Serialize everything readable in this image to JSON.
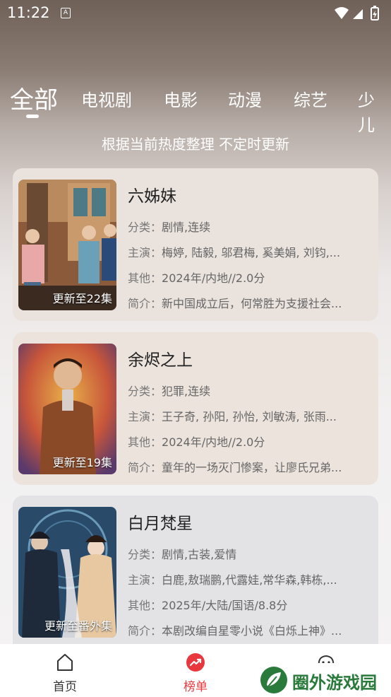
{
  "status_bar": {
    "time": "11:22",
    "notification_badge": "A"
  },
  "tabs": [
    {
      "label": "全部",
      "active": true
    },
    {
      "label": "电视剧"
    },
    {
      "label": "电影"
    },
    {
      "label": "动漫"
    },
    {
      "label": "综艺"
    },
    {
      "label": "少儿"
    }
  ],
  "subtitle": "根据当前热度整理 不定时更新",
  "labels": {
    "category": "分类：",
    "cast": "主演：",
    "other": "其他：",
    "intro": "简介："
  },
  "items": [
    {
      "title": "六姊妹",
      "badge": "更新至22集",
      "category": "剧情,连续",
      "cast": "梅婷, 陆毅, 邬君梅, 奚美娟, 刘钧,...",
      "other": "2024年/内地//2.0分",
      "intro": "新中国成立后，何常胜为支援社会..."
    },
    {
      "title": "余烬之上",
      "badge": "更新至19集",
      "category": "犯罪,连续",
      "cast": "王子奇, 孙阳, 孙怡, 刘敏涛, 张雨...",
      "other": "2024年/内地//2.0分",
      "intro": "童年的一场灭门惨案，让廖氏兄弟..."
    },
    {
      "title": "白月梵星",
      "badge": "更新至番外集",
      "category": "剧情,古装,爱情",
      "cast": "白鹿,敖瑞鹏,代露娃,常华森,韩栋,...",
      "other": "2025年/大陆/国语/8.8分",
      "intro": "本剧改编自星零小说《白烁上神》..."
    }
  ],
  "bottom_nav": [
    {
      "label": "首页",
      "icon": "home-icon"
    },
    {
      "label": "榜单",
      "icon": "trending-icon",
      "active": true
    },
    {
      "label": "",
      "icon": "chat-icon"
    }
  ],
  "watermark": "圈外游戏园",
  "colors": {
    "accent": "#e8383d",
    "watermark_green": "#2a7a3c"
  }
}
